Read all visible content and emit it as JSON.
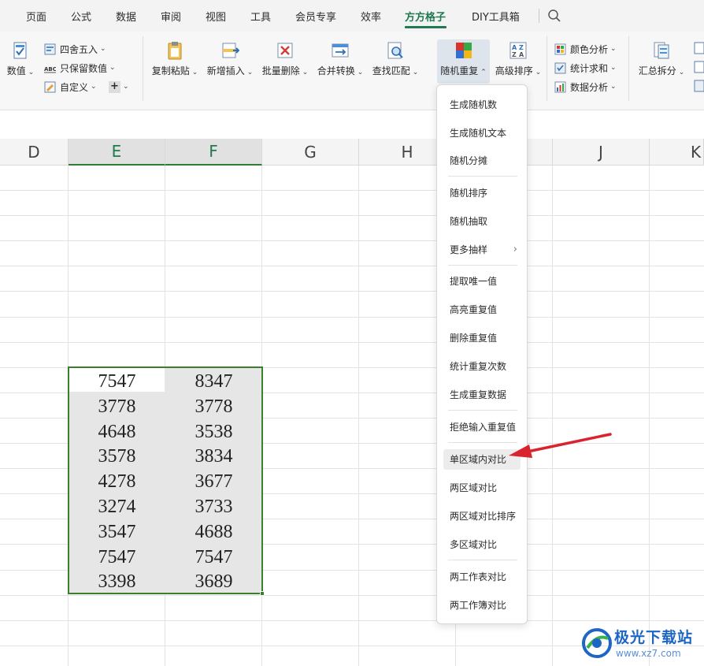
{
  "tabs": [
    {
      "label": "页面"
    },
    {
      "label": "公式"
    },
    {
      "label": "数据"
    },
    {
      "label": "审阅"
    },
    {
      "label": "视图"
    },
    {
      "label": "工具"
    },
    {
      "label": "会员专享"
    },
    {
      "label": "效率"
    },
    {
      "label": "方方格子",
      "active": true
    },
    {
      "label": "DIY工具箱"
    }
  ],
  "ribbon": {
    "numeric_label": "数值",
    "round_label": "四舍五入",
    "keep_values_label": "只保留数值",
    "custom_label": "自定义",
    "plus_label": "+",
    "copy_paste_label": "复制粘贴",
    "insert_label": "新增插入",
    "batch_delete_label": "批量删除",
    "merge_convert_label": "合并转换",
    "find_match_label": "查找匹配",
    "random_repeat_label": "随机重复",
    "advanced_sort_label": "高级排序",
    "color_analysis_label": "颜色分析",
    "stat_sum_label": "统计求和",
    "data_analysis_label": "数据分析",
    "summary_split_label": "汇总拆分"
  },
  "columns": [
    "D",
    "E",
    "F",
    "G",
    "H",
    "J",
    "K"
  ],
  "cells": [
    [
      "7547",
      "8347"
    ],
    [
      "3778",
      "3778"
    ],
    [
      "4648",
      "3538"
    ],
    [
      "3578",
      "3834"
    ],
    [
      "4278",
      "3677"
    ],
    [
      "3274",
      "3733"
    ],
    [
      "3547",
      "4688"
    ],
    [
      "7547",
      "7547"
    ],
    [
      "3398",
      "3689"
    ]
  ],
  "menu": {
    "items": [
      "生成随机数",
      "生成随机文本",
      "随机分摊",
      "随机排序",
      "随机抽取",
      "更多抽样",
      "提取唯一值",
      "高亮重复值",
      "删除重复值",
      "统计重复次数",
      "生成重复数据",
      "拒绝输入重复值",
      "单区域内对比",
      "两区域对比",
      "两区域对比排序",
      "多区域对比",
      "两工作表对比",
      "两工作簿对比"
    ],
    "highlighted": "单区域内对比"
  },
  "watermark": {
    "title": "极光下载站",
    "url": "www.xz7.com"
  },
  "colors": {
    "accent": "#1f7a4f",
    "selection_border": "#3a7f2c",
    "arrow": "#d9232e"
  }
}
